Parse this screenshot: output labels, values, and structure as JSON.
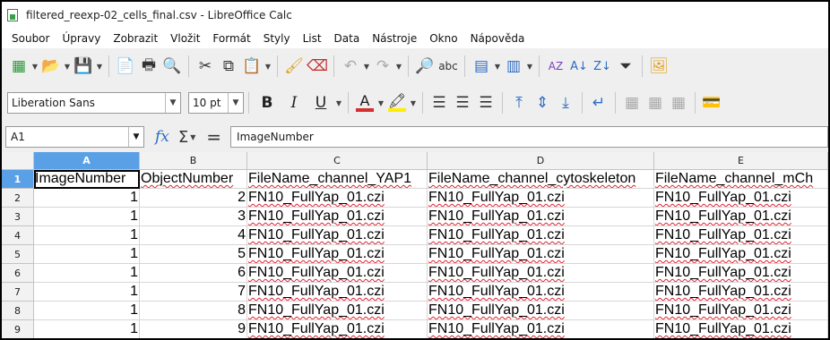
{
  "window": {
    "title": "filtered_reexp-02_cells_final.csv - LibreOffice Calc"
  },
  "menu": [
    "Soubor",
    "Úpravy",
    "Zobrazit",
    "Vložit",
    "Formát",
    "Styly",
    "List",
    "Data",
    "Nástroje",
    "Okno",
    "Nápověda"
  ],
  "format_toolbar": {
    "font_name": "Liberation Sans",
    "font_size": "10 pt",
    "bold": "B",
    "italic": "I",
    "underline": "U",
    "font_color_glyph": "A"
  },
  "formula_bar": {
    "name_box": "A1",
    "fx": "fx",
    "sigma": "Σ",
    "equals": "=",
    "content": "ImageNumber"
  },
  "colors": {
    "selected_header": "#5aa0e6",
    "font_color": "#d32f2f",
    "highlight": "#ffee00"
  },
  "grid": {
    "columns": [
      "A",
      "B",
      "C",
      "D",
      "E"
    ],
    "rows": [
      {
        "n": "1",
        "cells": [
          "ImageNumber",
          "ObjectNumber",
          "FileName_channel_YAP1",
          "FileName_channel_cytoskeleton",
          "FileName_channel_mCh"
        ]
      },
      {
        "n": "2",
        "cells": [
          "1",
          "2",
          "FN10_FullYap_01.czi",
          "FN10_FullYap_01.czi",
          "FN10_FullYap_01.czi"
        ]
      },
      {
        "n": "3",
        "cells": [
          "1",
          "3",
          "FN10_FullYap_01.czi",
          "FN10_FullYap_01.czi",
          "FN10_FullYap_01.czi"
        ]
      },
      {
        "n": "4",
        "cells": [
          "1",
          "4",
          "FN10_FullYap_01.czi",
          "FN10_FullYap_01.czi",
          "FN10_FullYap_01.czi"
        ]
      },
      {
        "n": "5",
        "cells": [
          "1",
          "5",
          "FN10_FullYap_01.czi",
          "FN10_FullYap_01.czi",
          "FN10_FullYap_01.czi"
        ]
      },
      {
        "n": "6",
        "cells": [
          "1",
          "6",
          "FN10_FullYap_01.czi",
          "FN10_FullYap_01.czi",
          "FN10_FullYap_01.czi"
        ]
      },
      {
        "n": "7",
        "cells": [
          "1",
          "7",
          "FN10_FullYap_01.czi",
          "FN10_FullYap_01.czi",
          "FN10_FullYap_01.czi"
        ]
      },
      {
        "n": "8",
        "cells": [
          "1",
          "8",
          "FN10_FullYap_01.czi",
          "FN10_FullYap_01.czi",
          "FN10_FullYap_01.czi"
        ]
      },
      {
        "n": "9",
        "cells": [
          "1",
          "9",
          "FN10_FullYap_01.czi",
          "FN10_FullYap_01.czi",
          "FN10_FullYap_01.czi"
        ]
      }
    ]
  }
}
